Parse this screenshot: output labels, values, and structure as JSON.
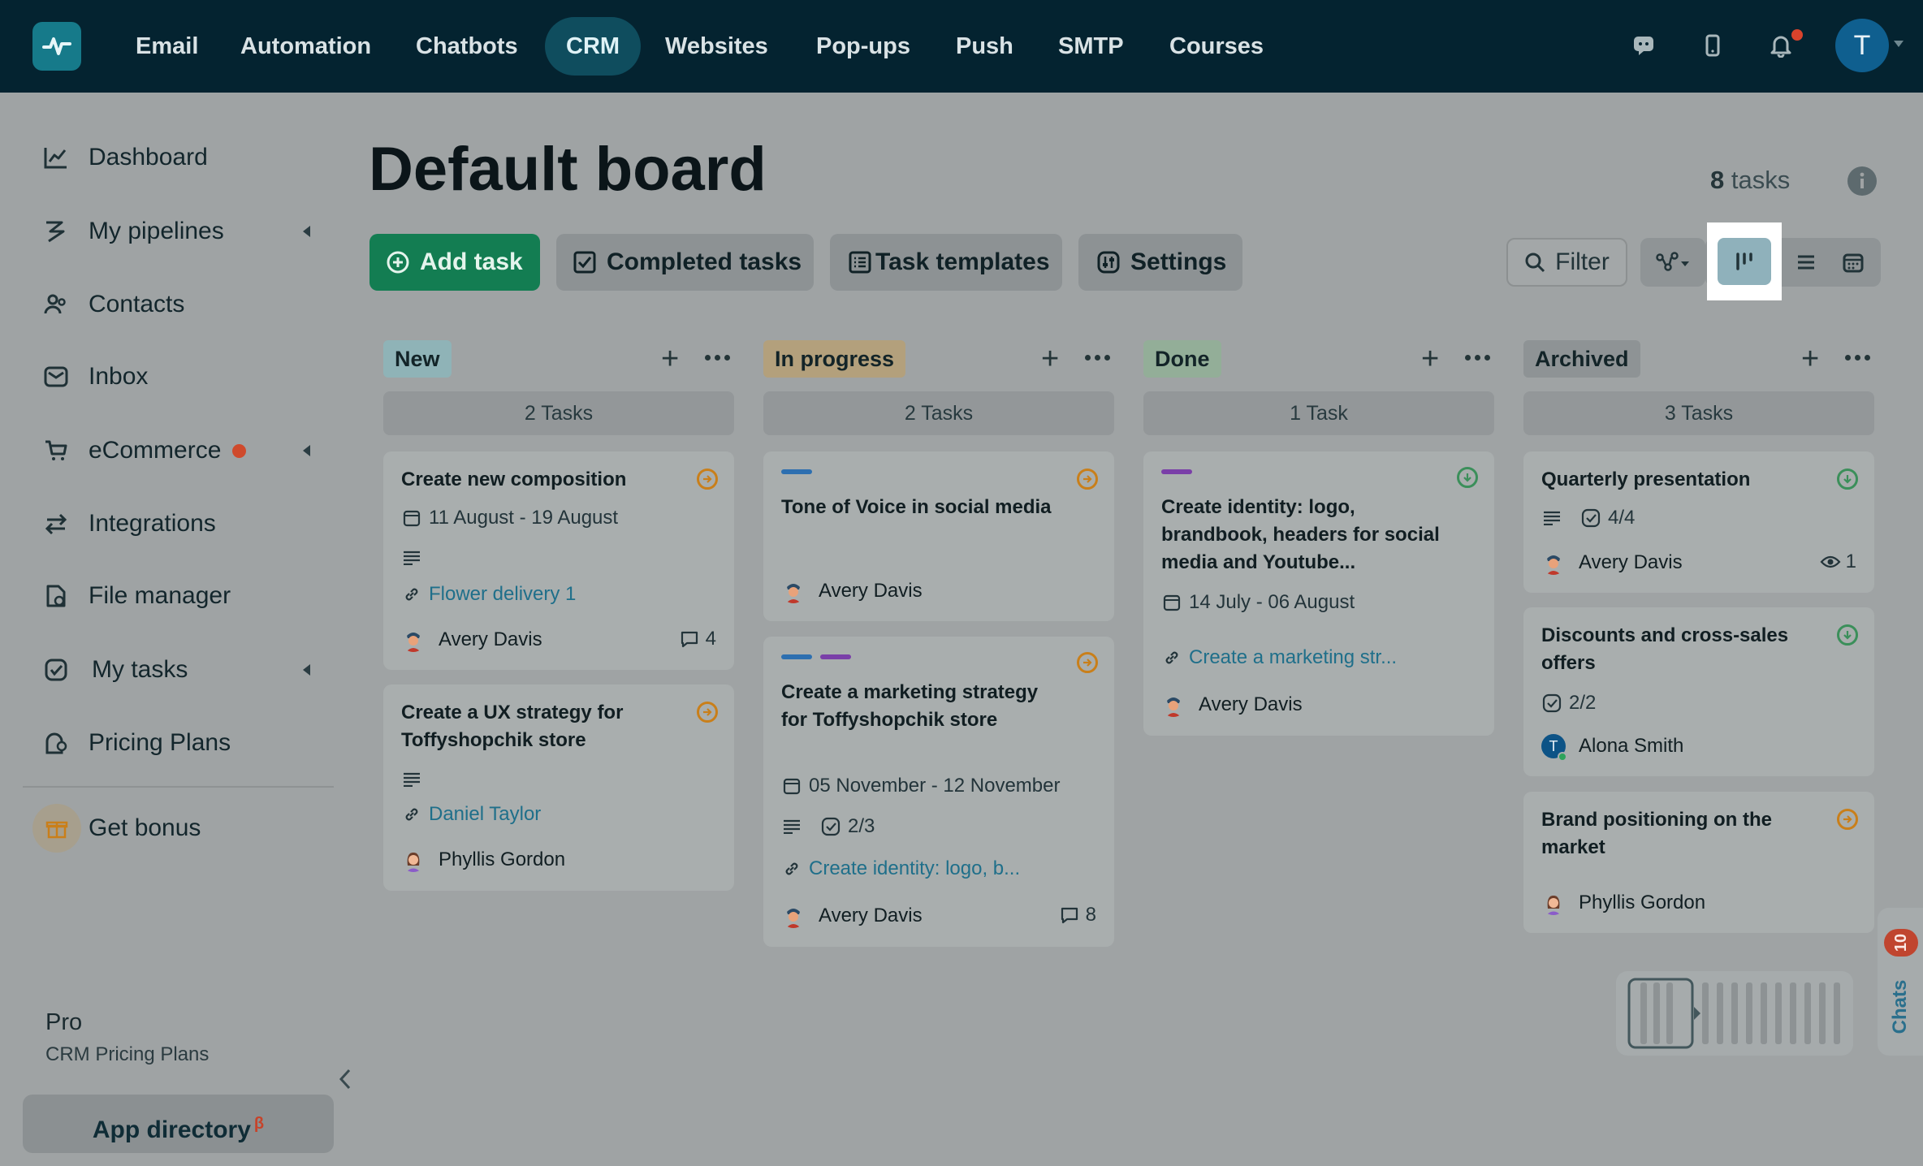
{
  "nav": {
    "items": [
      "Email",
      "Automation",
      "Chatbots",
      "CRM",
      "Websites",
      "Pop-ups",
      "Push",
      "SMTP",
      "Courses"
    ],
    "active": "CRM",
    "avatar_letter": "T"
  },
  "sidebar": {
    "items": [
      {
        "label": "Dashboard",
        "icon": "chart-line-icon"
      },
      {
        "label": "My pipelines",
        "icon": "pipeline-icon"
      },
      {
        "label": "Contacts",
        "icon": "contacts-icon"
      },
      {
        "label": "Inbox",
        "icon": "inbox-icon"
      },
      {
        "label": "eCommerce",
        "icon": "cart-icon"
      },
      {
        "label": "Integrations",
        "icon": "integrations-icon"
      },
      {
        "label": "File manager",
        "icon": "file-icon"
      },
      {
        "label": "My tasks",
        "icon": "tasks-icon"
      },
      {
        "label": "Pricing Plans",
        "icon": "pricing-icon"
      }
    ],
    "bonus_label": "Get bonus",
    "plan_name": "Pro",
    "plan_sub": "CRM Pricing Plans",
    "app_directory": "App directory",
    "app_directory_badge": "β"
  },
  "board": {
    "title": "Default board",
    "task_count_number": "8",
    "task_count_label": "tasks",
    "buttons": {
      "add_task": "Add task",
      "completed": "Completed tasks",
      "templates": "Task templates",
      "settings": "Settings",
      "filter": "Filter"
    }
  },
  "columns": [
    {
      "name": "New",
      "tag_color": "#8fb3b7",
      "count": "2 Tasks",
      "cards": [
        {
          "title": "Create new composition",
          "dates": "11 August - 19 August",
          "link": "Flower delivery 1",
          "person": "Avery Davis",
          "comments": "4"
        },
        {
          "title": "Create a UX strategy for Toffyshopchik store",
          "link": "Daniel Taylor",
          "person": "Phyllis Gordon"
        }
      ]
    },
    {
      "name": "In progress",
      "tag_color": "#b3a07c",
      "count": "2 Tasks",
      "cards": [
        {
          "title": "Tone of Voice in social media",
          "person": "Avery Davis"
        },
        {
          "title": "Create a marketing strategy for Toffyshopchik store",
          "dates": "05 November - 12 November",
          "checklist": "2/3",
          "link": "Create identity: logo, b...",
          "person": "Avery Davis",
          "comments": "8"
        }
      ]
    },
    {
      "name": "Done",
      "tag_color": "#93ae98",
      "count": "1 Task",
      "cards": [
        {
          "title": "Create identity: logo, brandbook, headers for social media and Youtube...",
          "dates": "14 July - 06 August",
          "link": "Create a marketing str...",
          "person": "Avery Davis"
        }
      ]
    },
    {
      "name": "Archived",
      "tag_color": "#8e9395",
      "count": "3 Tasks",
      "cards": [
        {
          "title": "Quarterly presentation",
          "checklist": "4/4",
          "person": "Avery Davis",
          "watchers": "1"
        },
        {
          "title": "Discounts and cross-sales offers",
          "checklist": "2/2",
          "person": "Alona Smith",
          "person_initial": "T"
        },
        {
          "title": "Brand positioning on the market",
          "person": "Phyllis Gordon"
        }
      ]
    }
  ],
  "chats": {
    "label": "Chats",
    "badge": "10"
  },
  "colors": {
    "topbar": "#042330",
    "primary_button": "#137d52",
    "accent_link": "#1f6f8a",
    "status_orange": "#c97f1a",
    "status_green": "#3b8f5a"
  }
}
